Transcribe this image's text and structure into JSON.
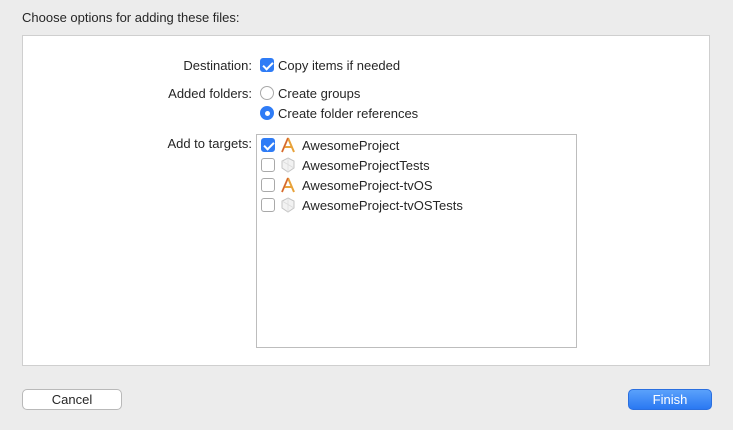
{
  "dialog": {
    "title": "Choose options for adding these files:"
  },
  "destination": {
    "label": "Destination:",
    "copy_label": "Copy items if needed",
    "copy_checked": true
  },
  "added_folders": {
    "label": "Added folders:",
    "options": [
      {
        "label": "Create groups",
        "selected": false
      },
      {
        "label": "Create folder references",
        "selected": true
      }
    ]
  },
  "targets": {
    "label": "Add to targets:",
    "items": [
      {
        "label": "AwesomeProject",
        "checked": true,
        "icon": "app-target-icon"
      },
      {
        "label": "AwesomeProjectTests",
        "checked": false,
        "icon": "test-target-icon"
      },
      {
        "label": "AwesomeProject-tvOS",
        "checked": false,
        "icon": "app-target-icon"
      },
      {
        "label": "AwesomeProject-tvOSTests",
        "checked": false,
        "icon": "test-target-icon"
      }
    ]
  },
  "buttons": {
    "cancel": "Cancel",
    "finish": "Finish"
  },
  "colors": {
    "accent": "#2f7cf6",
    "background": "#ececec",
    "panel": "#ffffff"
  }
}
